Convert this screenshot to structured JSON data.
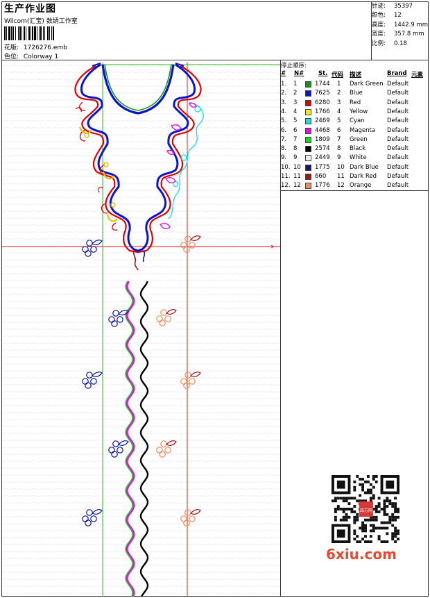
{
  "header": {
    "title": "生产作业图",
    "subtitle": "Wilcom(汇宝) 数绣工作室",
    "design_label": "花版:",
    "design_value": "1726276.emb",
    "colorway_label": "色位:",
    "colorway_value": "Colorway 1"
  },
  "stats": [
    {
      "label": "针迹:",
      "value": "35397"
    },
    {
      "label": "颜色:",
      "value": "12"
    },
    {
      "label": "高度:",
      "value": "1442.9 mm"
    },
    {
      "label": "宽度:",
      "value": "357.8 mm"
    },
    {
      "label": "比例:",
      "value": "0.18"
    }
  ],
  "table": {
    "title": "停止顺序:",
    "headers": {
      "idx": "#",
      "no": "N#",
      "st": "St.",
      "code": "代码",
      "desc": "描述",
      "brand": "Brand",
      "elem": "元素"
    },
    "rows": [
      {
        "idx": "1.",
        "no": "1",
        "color": "#149414",
        "st": "1744",
        "code": "1",
        "desc": "Dark Green",
        "brand": "Default"
      },
      {
        "idx": "2.",
        "no": "2",
        "color": "#0a14c8",
        "st": "7625",
        "code": "2",
        "desc": "Blue",
        "brand": "Default"
      },
      {
        "idx": "3.",
        "no": "3",
        "color": "#e00000",
        "st": "6280",
        "code": "3",
        "desc": "Red",
        "brand": "Default"
      },
      {
        "idx": "4.",
        "no": "4",
        "color": "#f0f000",
        "st": "1766",
        "code": "4",
        "desc": "Yellow",
        "brand": "Default"
      },
      {
        "idx": "5.",
        "no": "5",
        "color": "#10e0e0",
        "st": "2469",
        "code": "5",
        "desc": "Cyan",
        "brand": "Default"
      },
      {
        "idx": "6.",
        "no": "6",
        "color": "#e010e0",
        "st": "4468",
        "code": "6",
        "desc": "Magenta",
        "brand": "Default"
      },
      {
        "idx": "7.",
        "no": "7",
        "color": "#10e010",
        "st": "1809",
        "code": "7",
        "desc": "Green",
        "brand": "Default"
      },
      {
        "idx": "8.",
        "no": "8",
        "color": "#000000",
        "st": "2574",
        "code": "8",
        "desc": "Black",
        "brand": "Default"
      },
      {
        "idx": "9.",
        "no": "9",
        "color": "#f0f0f0",
        "st": "2449",
        "code": "9",
        "desc": "White",
        "brand": "Default"
      },
      {
        "idx": "10.",
        "no": "10",
        "color": "#141478",
        "st": "1775",
        "code": "10",
        "desc": "Dark Blue",
        "brand": "Default"
      },
      {
        "idx": "11.",
        "no": "11",
        "color": "#a01414",
        "st": "660",
        "code": "11",
        "desc": "Dark Red",
        "brand": "Default"
      },
      {
        "idx": "12.",
        "no": "12",
        "color": "#f08c5a",
        "st": "1776",
        "code": "12",
        "desc": "Orange",
        "brand": "Default"
      }
    ]
  },
  "watermark": "6xiu.com",
  "qr_seal": "四方网"
}
